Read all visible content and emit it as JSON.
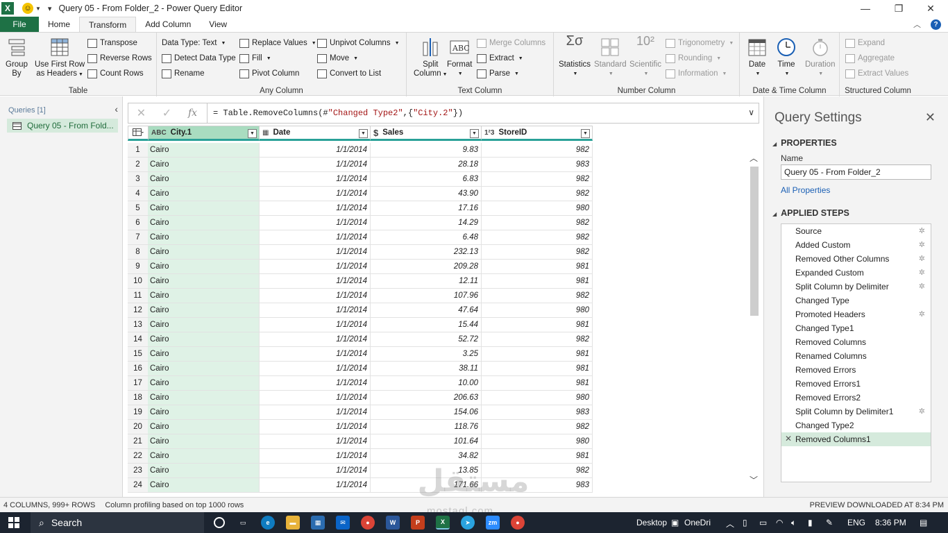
{
  "window": {
    "app_logo": "X",
    "title": "Query 05 - From Folder_2 - Power Query Editor"
  },
  "tabs": [
    {
      "label": "File"
    },
    {
      "label": "Home"
    },
    {
      "label": "Transform"
    },
    {
      "label": "Add Column"
    },
    {
      "label": "View"
    }
  ],
  "ribbon": {
    "table": {
      "label": "Table",
      "group_by_1": "Group",
      "group_by_2": "By",
      "first_row_1": "Use First Row",
      "first_row_2": "as Headers",
      "transpose": "Transpose",
      "reverse_rows": "Reverse Rows",
      "count_rows": "Count Rows"
    },
    "any_column": {
      "label": "Any Column",
      "data_type": "Data Type: Text",
      "detect": "Detect Data Type",
      "rename": "Rename",
      "replace": "Replace Values",
      "fill": "Fill",
      "pivot": "Pivot Column",
      "unpivot": "Unpivot Columns",
      "move": "Move",
      "convert": "Convert to List"
    },
    "text_column": {
      "label": "Text Column",
      "split_1": "Split",
      "split_2": "Column",
      "format": "Format",
      "merge": "Merge Columns",
      "extract": "Extract",
      "parse": "Parse"
    },
    "number_column": {
      "label": "Number Column",
      "statistics": "Statistics",
      "standard": "Standard",
      "scientific": "Scientific",
      "trig": "Trigonometry",
      "rounding": "Rounding",
      "information": "Information"
    },
    "datetime": {
      "label": "Date & Time Column",
      "date": "Date",
      "time": "Time",
      "duration": "Duration"
    },
    "structured": {
      "label": "Structured Column",
      "expand": "Expand",
      "aggregate": "Aggregate",
      "extract_values": "Extract Values"
    }
  },
  "queries": {
    "header": "Queries [1]",
    "item": "Query 05 - From Fold..."
  },
  "formula": {
    "prefix": "= Table.RemoveColumns(#",
    "str1": "\"Changed Type2\"",
    "mid": ",{",
    "str2": "\"City.2\"",
    "suffix": "})"
  },
  "grid": {
    "columns": [
      {
        "type": "ABC",
        "name": "City.1"
      },
      {
        "type": "▦",
        "name": "Date"
      },
      {
        "type": "$",
        "name": "Sales"
      },
      {
        "type": "1²3",
        "name": "StoreID"
      }
    ],
    "rows": [
      {
        "n": "1",
        "city": "Cairo",
        "date": "1/1/2014",
        "sales": "9.83",
        "store": "982"
      },
      {
        "n": "2",
        "city": "Cairo",
        "date": "1/1/2014",
        "sales": "28.18",
        "store": "983"
      },
      {
        "n": "3",
        "city": "Cairo",
        "date": "1/1/2014",
        "sales": "6.83",
        "store": "982"
      },
      {
        "n": "4",
        "city": "Cairo",
        "date": "1/1/2014",
        "sales": "43.90",
        "store": "982"
      },
      {
        "n": "5",
        "city": "Cairo",
        "date": "1/1/2014",
        "sales": "17.16",
        "store": "980"
      },
      {
        "n": "6",
        "city": "Cairo",
        "date": "1/1/2014",
        "sales": "14.29",
        "store": "982"
      },
      {
        "n": "7",
        "city": "Cairo",
        "date": "1/1/2014",
        "sales": "6.48",
        "store": "982"
      },
      {
        "n": "8",
        "city": "Cairo",
        "date": "1/1/2014",
        "sales": "232.13",
        "store": "982"
      },
      {
        "n": "9",
        "city": "Cairo",
        "date": "1/1/2014",
        "sales": "209.28",
        "store": "981"
      },
      {
        "n": "10",
        "city": "Cairo",
        "date": "1/1/2014",
        "sales": "12.11",
        "store": "981"
      },
      {
        "n": "11",
        "city": "Cairo",
        "date": "1/1/2014",
        "sales": "107.96",
        "store": "982"
      },
      {
        "n": "12",
        "city": "Cairo",
        "date": "1/1/2014",
        "sales": "47.64",
        "store": "980"
      },
      {
        "n": "13",
        "city": "Cairo",
        "date": "1/1/2014",
        "sales": "15.44",
        "store": "981"
      },
      {
        "n": "14",
        "city": "Cairo",
        "date": "1/1/2014",
        "sales": "52.72",
        "store": "982"
      },
      {
        "n": "15",
        "city": "Cairo",
        "date": "1/1/2014",
        "sales": "3.25",
        "store": "981"
      },
      {
        "n": "16",
        "city": "Cairo",
        "date": "1/1/2014",
        "sales": "38.11",
        "store": "981"
      },
      {
        "n": "17",
        "city": "Cairo",
        "date": "1/1/2014",
        "sales": "10.00",
        "store": "981"
      },
      {
        "n": "18",
        "city": "Cairo",
        "date": "1/1/2014",
        "sales": "206.63",
        "store": "980"
      },
      {
        "n": "19",
        "city": "Cairo",
        "date": "1/1/2014",
        "sales": "154.06",
        "store": "983"
      },
      {
        "n": "20",
        "city": "Cairo",
        "date": "1/1/2014",
        "sales": "118.76",
        "store": "982"
      },
      {
        "n": "21",
        "city": "Cairo",
        "date": "1/1/2014",
        "sales": "101.64",
        "store": "980"
      },
      {
        "n": "22",
        "city": "Cairo",
        "date": "1/1/2014",
        "sales": "34.82",
        "store": "981"
      },
      {
        "n": "23",
        "city": "Cairo",
        "date": "1/1/2014",
        "sales": "13.85",
        "store": "982"
      },
      {
        "n": "24",
        "city": "Cairo",
        "date": "1/1/2014",
        "sales": "171.66",
        "store": "983"
      }
    ]
  },
  "settings": {
    "title": "Query Settings",
    "properties_header": "PROPERTIES",
    "name_label": "Name",
    "name_value": "Query 05 - From Folder_2",
    "all_properties": "All Properties",
    "steps_header": "APPLIED STEPS",
    "steps": [
      {
        "label": "Source",
        "gear": true
      },
      {
        "label": "Added Custom",
        "gear": true
      },
      {
        "label": "Removed Other Columns",
        "gear": true
      },
      {
        "label": "Expanded Custom",
        "gear": true
      },
      {
        "label": "Split Column by Delimiter",
        "gear": true
      },
      {
        "label": "Changed Type",
        "gear": false
      },
      {
        "label": "Promoted Headers",
        "gear": true
      },
      {
        "label": "Changed Type1",
        "gear": false
      },
      {
        "label": "Removed Columns",
        "gear": false
      },
      {
        "label": "Renamed Columns",
        "gear": false
      },
      {
        "label": "Removed Errors",
        "gear": false
      },
      {
        "label": "Removed Errors1",
        "gear": false
      },
      {
        "label": "Removed Errors2",
        "gear": false
      },
      {
        "label": "Split Column by Delimiter1",
        "gear": true
      },
      {
        "label": "Changed Type2",
        "gear": false
      },
      {
        "label": "Removed Columns1",
        "gear": false,
        "active": true
      }
    ]
  },
  "status": {
    "columns": "4 COLUMNS, 999+ ROWS",
    "profiling": "Column profiling based on top 1000 rows",
    "preview": "PREVIEW DOWNLOADED AT 8:34 PM"
  },
  "watermark": {
    "main": "مستقل",
    "sub": "mostaql.com"
  },
  "taskbar": {
    "search": "Search",
    "desktop": "Desktop",
    "onedrive": "OneDri",
    "lang": "ENG",
    "time": "8:36 PM"
  },
  "colors": {
    "excel_green": "#1e7145",
    "selected_column": "#a9dcc0",
    "selected_cells": "#dff2e6",
    "header_accent": "#2aa198",
    "link_blue": "#1a5fb4"
  }
}
